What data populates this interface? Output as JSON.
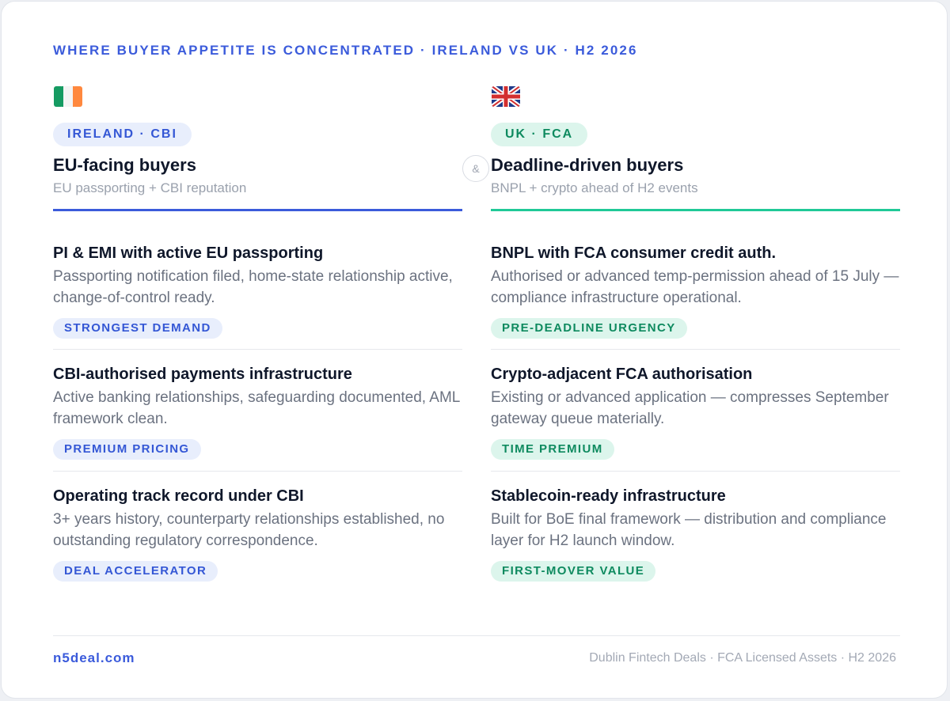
{
  "header": {
    "title": "WHERE BUYER APPETITE IS CONCENTRATED · IRELAND VS UK · H2 2026"
  },
  "separator": {
    "symbol": "&"
  },
  "colors": {
    "blue_accent": "#3b5bdb",
    "green_accent": "#20c997",
    "blue_badge_bg": "#e8eefc",
    "green_badge_bg": "#dcf5ec"
  },
  "left": {
    "flag_icon": "ireland-flag-icon",
    "region_label": "IRELAND · CBI",
    "title": "EU-facing buyers",
    "subtitle": "EU passporting + CBI reputation",
    "items": [
      {
        "title": "PI & EMI with active EU passporting",
        "desc": "Passporting notification filed, home-state relationship active, change-of-control ready.",
        "badge": "STRONGEST DEMAND"
      },
      {
        "title": "CBI-authorised payments infrastructure",
        "desc": "Active banking relationships, safeguarding documented, AML framework clean.",
        "badge": "PREMIUM PRICING"
      },
      {
        "title": "Operating track record under CBI",
        "desc": "3+ years history, counterparty relationships established, no outstanding regulatory correspondence.",
        "badge": "DEAL ACCELERATOR"
      }
    ]
  },
  "right": {
    "flag_icon": "uk-flag-icon",
    "region_label": "UK · FCA",
    "title": "Deadline-driven buyers",
    "subtitle": "BNPL + crypto ahead of H2 events",
    "items": [
      {
        "title": "BNPL with FCA consumer credit auth.",
        "desc": "Authorised or advanced temp-permission ahead of 15 July — compliance infrastructure operational.",
        "badge": "PRE-DEADLINE URGENCY"
      },
      {
        "title": "Crypto-adjacent FCA authorisation",
        "desc": "Existing or advanced application — compresses September gateway queue materially.",
        "badge": "TIME PREMIUM"
      },
      {
        "title": "Stablecoin-ready infrastructure",
        "desc": "Built for BoE final framework — distribution and compliance layer for H2 launch window.",
        "badge": "FIRST-MOVER VALUE"
      }
    ]
  },
  "footer": {
    "brand": "n5deal.com",
    "note": "Dublin Fintech Deals · FCA Licensed Assets · H2 2026"
  }
}
